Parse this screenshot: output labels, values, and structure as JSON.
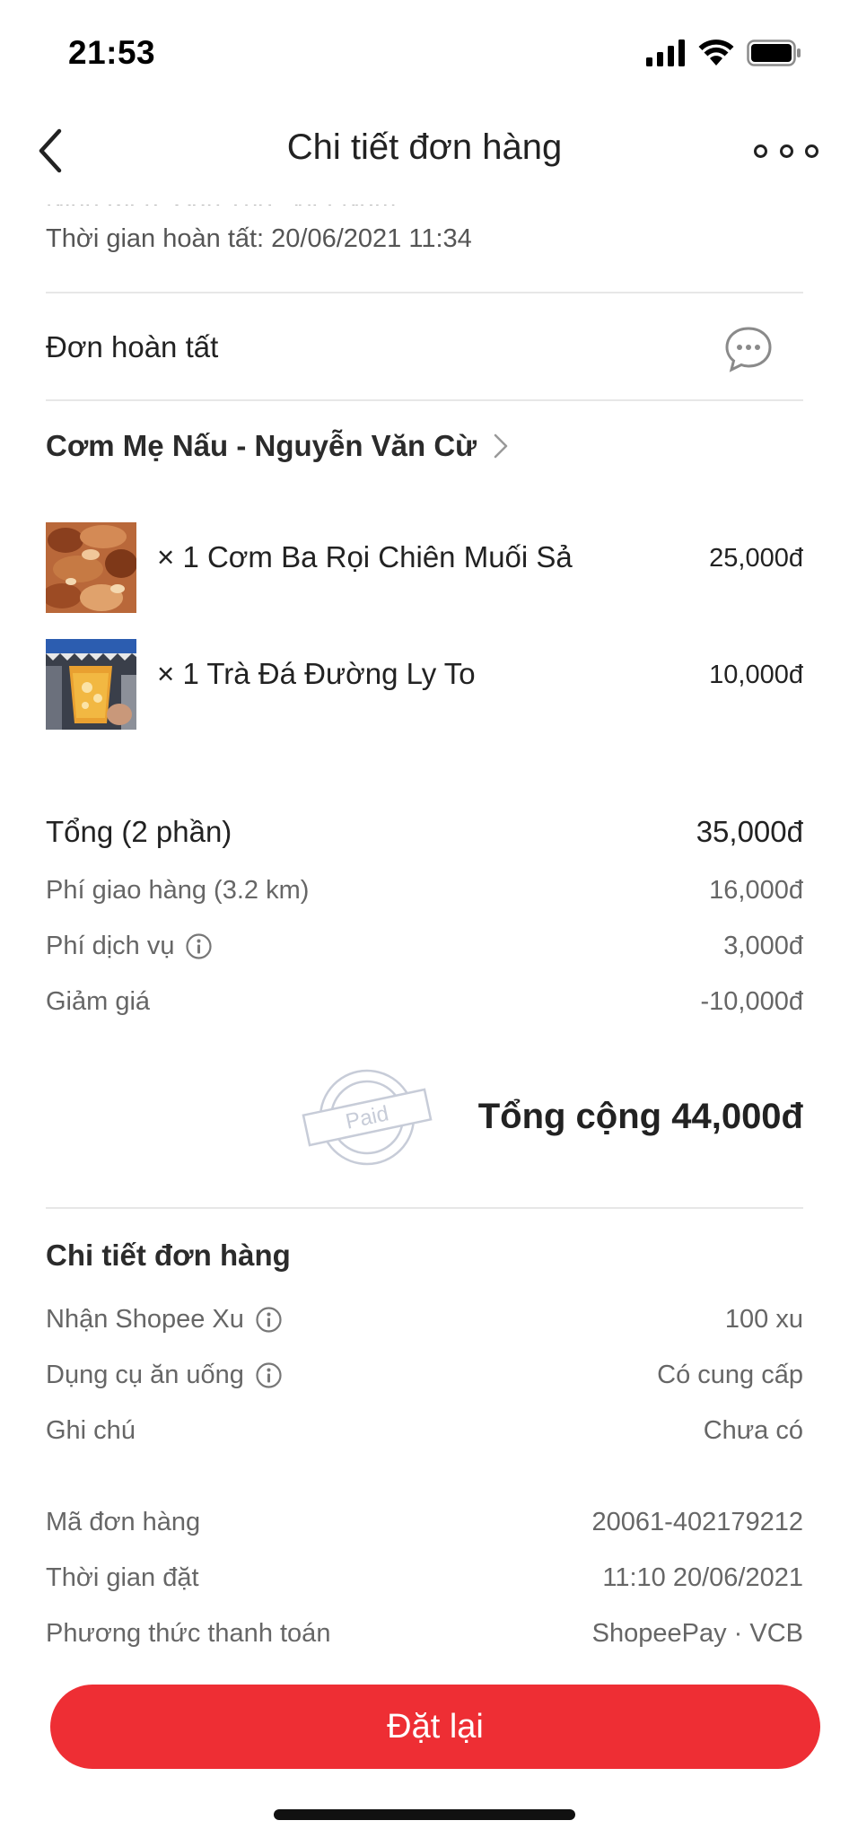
{
  "status_bar": {
    "time": "21:53"
  },
  "nav": {
    "title": "Chi tiết đơn hàng"
  },
  "delivery": {
    "address_partial": "Ninh Kiều, Cần Thơ, Việt Nam",
    "completed_time": "Thời gian hoàn tất: 20/06/2021 11:34"
  },
  "order_status": {
    "label": "Đơn hoàn tất"
  },
  "restaurant": {
    "name": "Cơm Mẹ Nấu - Nguyễn Văn Cừ"
  },
  "items": [
    {
      "qty_name": "× 1  Cơm Ba Rọi Chiên Muối Sả",
      "price": "25,000đ",
      "icon": "fried-pork-rice-photo"
    },
    {
      "qty_name": "× 1  Trà Đá Đường Ly To",
      "price": "10,000đ",
      "icon": "iced-tea-photo"
    }
  ],
  "summary": {
    "subtotal_label": "Tổng (2 phần)",
    "subtotal_value": "35,000đ",
    "delivery_fee_label": "Phí giao hàng (3.2 km)",
    "delivery_fee_value": "16,000đ",
    "service_fee_label": "Phí dịch vụ",
    "service_fee_value": "3,000đ",
    "discount_label": "Giảm giá",
    "discount_value": "-10,000đ",
    "paid_stamp": "Paid",
    "grand_total": "Tổng cộng 44,000đ"
  },
  "details": {
    "title": "Chi tiết đơn hàng",
    "rows": [
      {
        "label": "Nhận Shopee Xu",
        "value": "100 xu"
      },
      {
        "label": "Dụng cụ ăn uống",
        "value": "Có cung cấp"
      },
      {
        "label": "Ghi chú",
        "value": "Chưa có"
      },
      {
        "label": "Mã đơn hàng",
        "value": "20061-402179212"
      },
      {
        "label": "Thời gian đặt",
        "value": "11:10 20/06/2021"
      },
      {
        "label": "Phương thức thanh toán",
        "value": "ShopeePay · VCB"
      }
    ]
  },
  "cta": {
    "label": "Đặt lại"
  },
  "colors": {
    "accent": "#ee2e34",
    "text": "#222222",
    "muted": "#666666",
    "divider": "#e7e7e7"
  }
}
